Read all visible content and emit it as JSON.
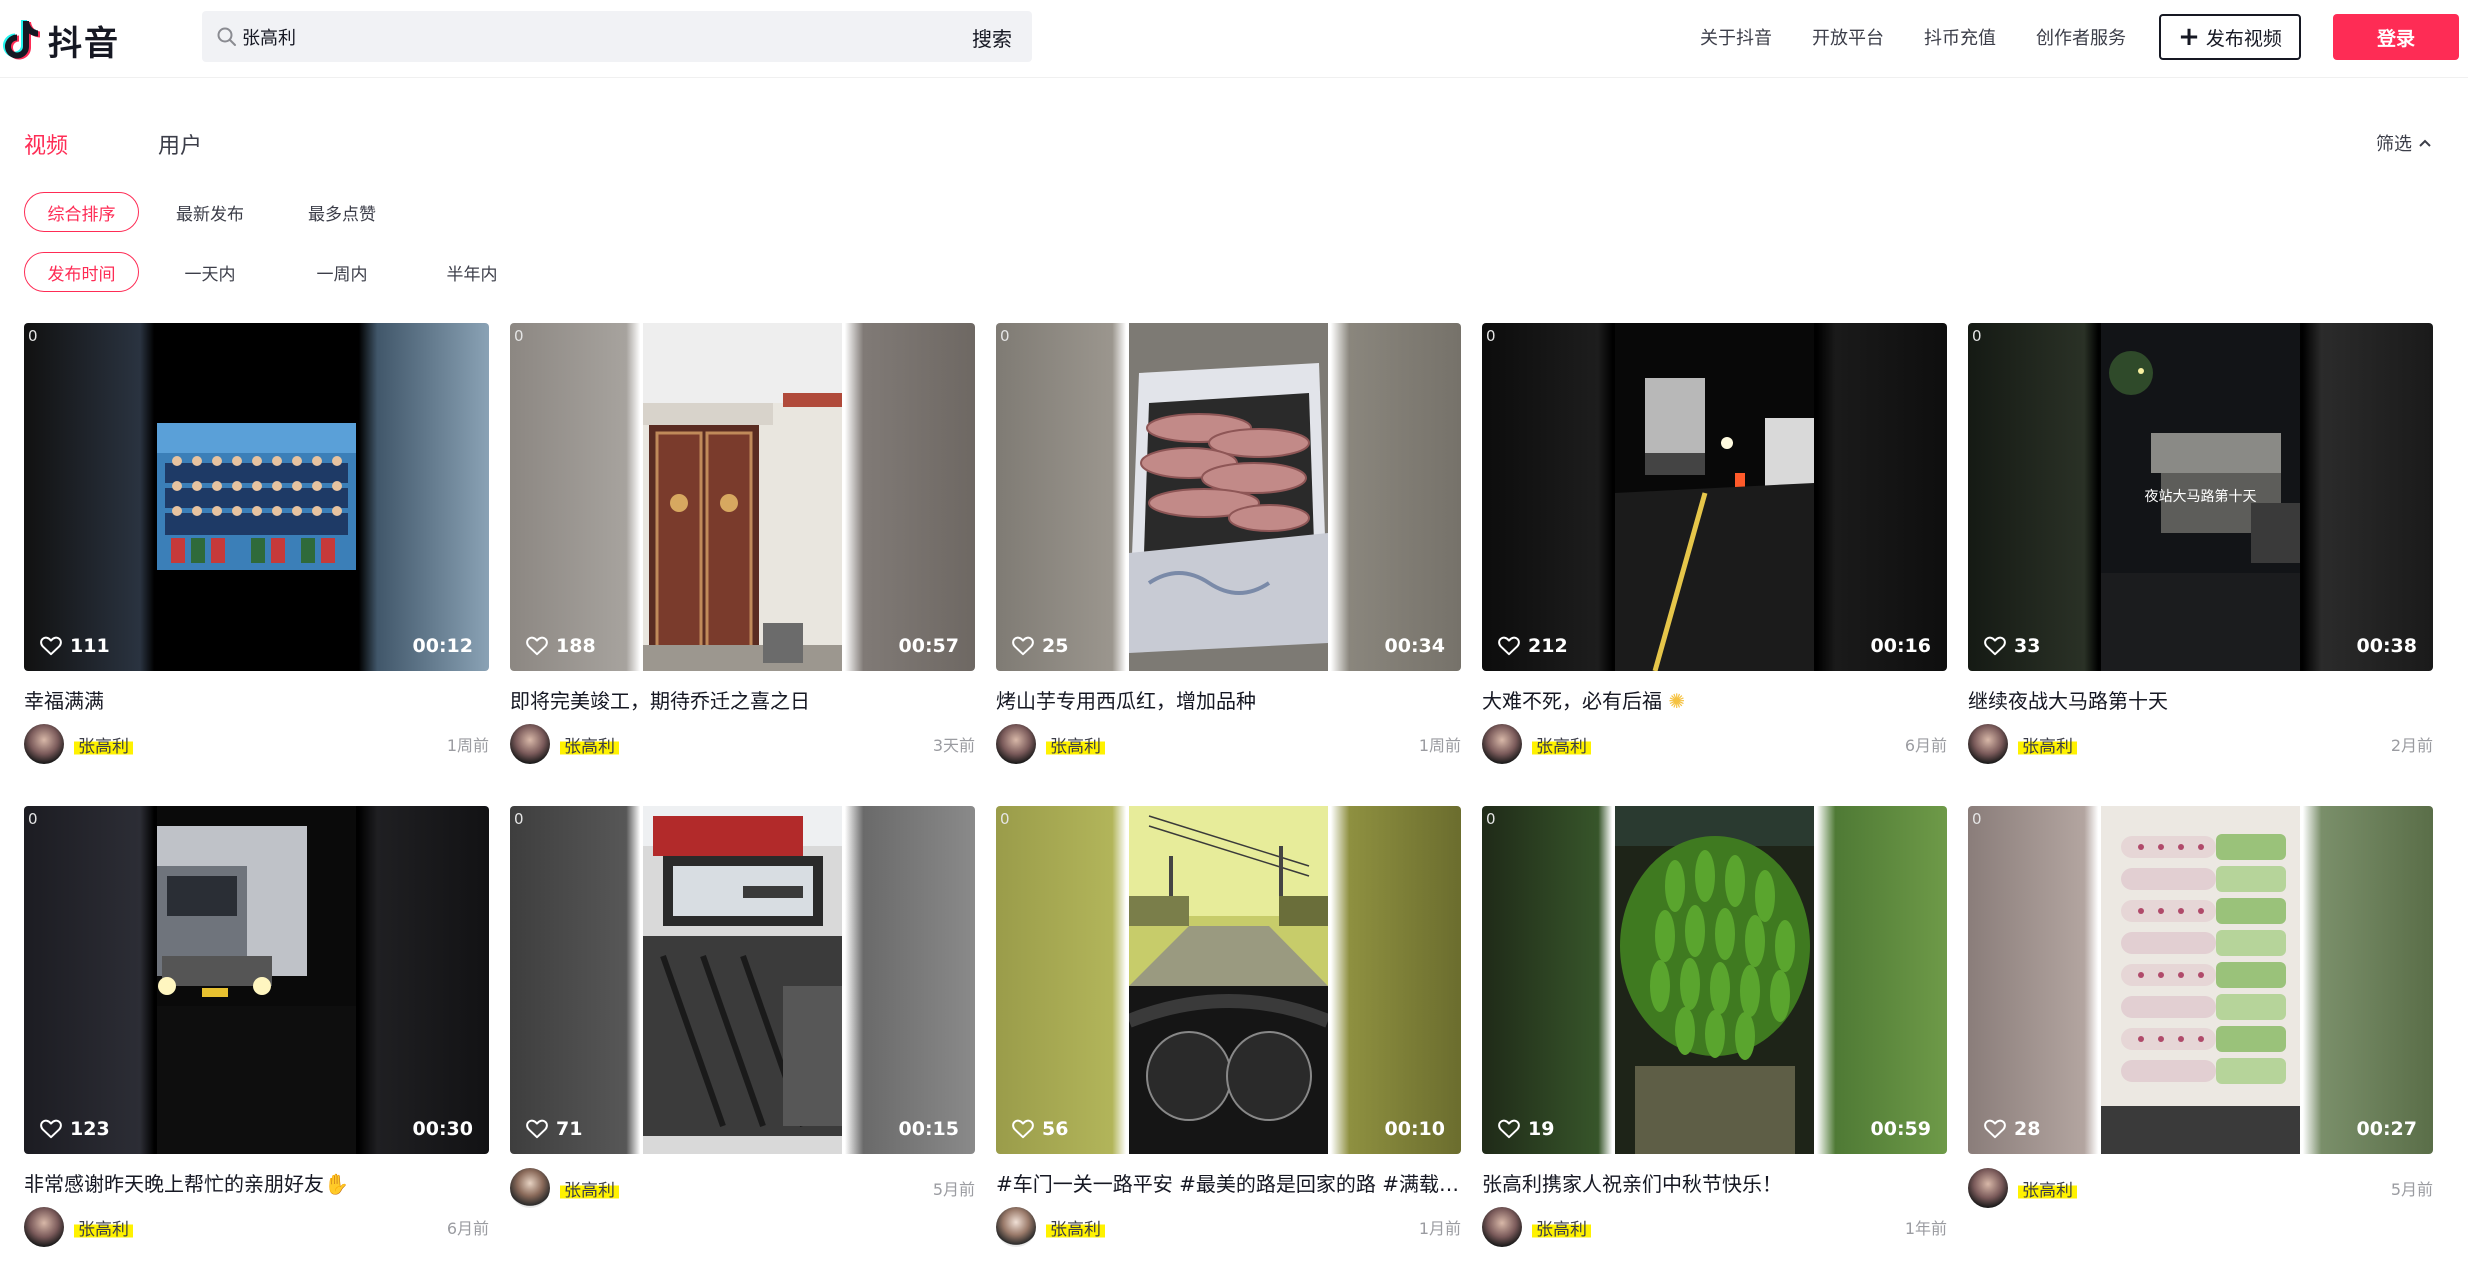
{
  "app": {
    "logo_text": "抖音"
  },
  "search": {
    "value": "张高利",
    "button_label": "搜索"
  },
  "nav": {
    "links": [
      "关于抖音",
      "开放平台",
      "抖币充值",
      "创作者服务"
    ],
    "upload_label": "发布视频",
    "login_label": "登录"
  },
  "tabs": {
    "videos": "视频",
    "users": "用户",
    "filter_label": "筛选"
  },
  "sort_options": [
    "综合排序",
    "最新发布",
    "最多点赞"
  ],
  "time_options": [
    "发布时间",
    "一天内",
    "一周内",
    "半年内"
  ],
  "colors": {
    "accent": "#fe2c55",
    "highlight": "#fff200"
  },
  "cards": [
    {
      "badge": "0",
      "likes": "111",
      "duration": "00:12",
      "title": "幸福满满",
      "author": "张高利",
      "age": "1周前"
    },
    {
      "badge": "0",
      "likes": "188",
      "duration": "00:57",
      "title": "即将完美竣工，期待乔迁之喜之日",
      "author": "张高利",
      "age": "3天前"
    },
    {
      "badge": "0",
      "likes": "25",
      "duration": "00:34",
      "title": "烤山芋专用西瓜红，增加品种",
      "author": "张高利",
      "age": "1周前"
    },
    {
      "badge": "0",
      "likes": "212",
      "duration": "00:16",
      "title": "大难不死，必有后福",
      "author": "张高利",
      "age": "6月前"
    },
    {
      "badge": "0",
      "likes": "33",
      "duration": "00:38",
      "title": "继续夜战大马路第十天",
      "author": "张高利",
      "age": "2月前",
      "overlay": "夜站大马路第十天"
    },
    {
      "badge": "0",
      "likes": "123",
      "duration": "00:30",
      "title": "非常感谢昨天晚上帮忙的亲朋好友",
      "author": "张高利",
      "age": "6月前"
    },
    {
      "badge": "0",
      "likes": "71",
      "duration": "00:15",
      "title": "",
      "author": "张高利",
      "age": "5月前"
    },
    {
      "badge": "0",
      "likes": "56",
      "duration": "00:10",
      "title": "#车门一关一路平安 #最美的路是回家的路 #满载…",
      "author": "张高利",
      "age": "1月前"
    },
    {
      "badge": "0",
      "likes": "19",
      "duration": "00:59",
      "title": "张高利携家人祝亲们中秋节快乐！",
      "author": "张高利",
      "age": "1年前"
    },
    {
      "badge": "0",
      "likes": "28",
      "duration": "00:27",
      "title": "",
      "author": "张高利",
      "age": "5月前"
    }
  ]
}
